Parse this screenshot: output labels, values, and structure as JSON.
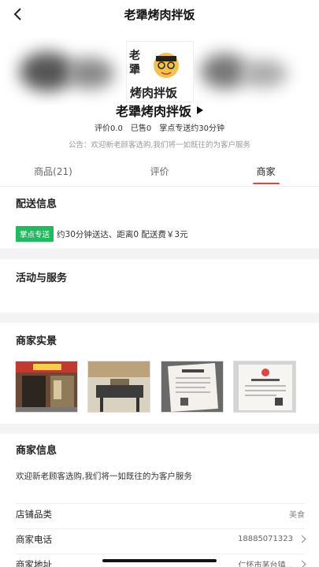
{
  "nav": {
    "title": "老犟烤肉拌饭"
  },
  "shop": {
    "name": "老犟烤肉拌饭",
    "logo_text": "老犟 烤肉拌饭",
    "rating": "评价0.0",
    "sold": "已售0",
    "delivery": "掌点专送约30分钟",
    "notice": "公告：欢迎新老顾客选购,我们将一如既往的为客户服务"
  },
  "tabs": [
    {
      "label": "商品(21)"
    },
    {
      "label": "评价"
    },
    {
      "label": "商家"
    }
  ],
  "delivery_section": {
    "title": "配送信息",
    "tag": "掌点专送",
    "text": "约30分钟送达、距离0 配送费￥3元"
  },
  "activity_section": {
    "title": "活动与服务"
  },
  "photos_section": {
    "title": "商家实景"
  },
  "info_section": {
    "title": "商家信息",
    "description": "欢迎新老顾客选购,我们将一如既往的为客户服务",
    "rows": [
      {
        "label": "店铺品类",
        "value": "美食"
      },
      {
        "label": "商家电话",
        "value": "18885071323"
      },
      {
        "label": "商家地址",
        "value": "仁怀市茅台镇..."
      }
    ]
  },
  "colors": {
    "accent": "#e8443a",
    "tag_green": "#1fbb5f"
  }
}
